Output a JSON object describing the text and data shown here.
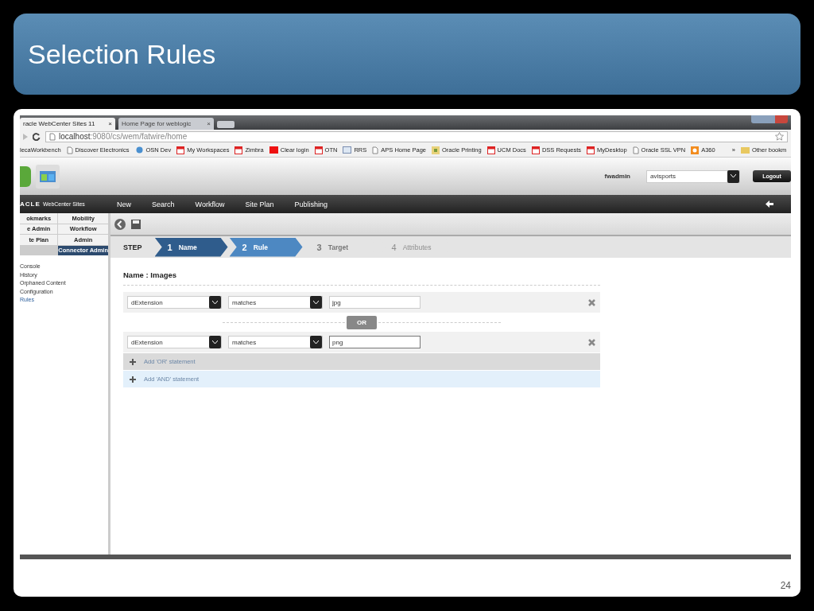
{
  "slide": {
    "title": "Selection Rules",
    "page_number": "24"
  },
  "browser": {
    "tabs": [
      {
        "label": "racle WebCenter Sites 11",
        "close": "×",
        "selected": true
      },
      {
        "label": "Home Page for weblogic",
        "close": "×",
        "selected": false
      }
    ],
    "url_host": "localhost",
    "url_path": ":9080/cs/wem/fatwire/home",
    "bookmarks": [
      {
        "label": "lecaWorkbench",
        "kind": "none"
      },
      {
        "label": "Discover Electronics",
        "kind": "page"
      },
      {
        "label": "OSN Dev",
        "kind": "globe"
      },
      {
        "label": "My Workspaces",
        "kind": "red"
      },
      {
        "label": "Zimbra",
        "kind": "red"
      },
      {
        "label": "Clear login",
        "kind": "redbar"
      },
      {
        "label": "OTN",
        "kind": "red"
      },
      {
        "label": "RRS",
        "kind": "window"
      },
      {
        "label": "APS Home Page",
        "kind": "page"
      },
      {
        "label": "Oracle Printing",
        "kind": "yellow"
      },
      {
        "label": "UCM Docs",
        "kind": "red"
      },
      {
        "label": "DSS Requests",
        "kind": "red"
      },
      {
        "label": "MyDesktop",
        "kind": "red"
      },
      {
        "label": "Oracle SSL VPN",
        "kind": "page"
      },
      {
        "label": "A360",
        "kind": "orange"
      }
    ],
    "overflow": "»",
    "other_bookmarks": "Other bookm"
  },
  "app": {
    "user": "fwadmin",
    "site": "avisports",
    "logout": "Logout",
    "logo": "ACLE",
    "product": "WebCenter Sites",
    "menu": [
      "New",
      "Search",
      "Workflow",
      "Site Plan",
      "Publishing"
    ],
    "sidebar_tabs": [
      {
        "label": "okmarks",
        "selected": false
      },
      {
        "label": "Mobility",
        "selected": false
      },
      {
        "label": "e Admin",
        "selected": false
      },
      {
        "label": "Workflow",
        "selected": false
      },
      {
        "label": "te Plan",
        "selected": false
      },
      {
        "label": "Admin",
        "selected": false
      },
      {
        "label": "Connector Admin",
        "selected": true
      }
    ],
    "sidebar_links": [
      {
        "label": "Console",
        "selected": false
      },
      {
        "label": "History",
        "selected": false
      },
      {
        "label": "Orphaned Content",
        "selected": false
      },
      {
        "label": "Configuration",
        "selected": false
      },
      {
        "label": "Rules",
        "selected": true
      }
    ],
    "steps_label": "STEP",
    "steps": [
      {
        "number": "1",
        "label": "Name",
        "completed": true,
        "selected": false,
        "disabled": false
      },
      {
        "number": "2",
        "label": "Rule",
        "completed": false,
        "selected": true,
        "disabled": false
      },
      {
        "number": "3",
        "label": "Target",
        "completed": false,
        "selected": false,
        "disabled": false
      },
      {
        "number": "4",
        "label": "Attributes",
        "completed": false,
        "selected": false,
        "disabled": true
      }
    ],
    "name_heading": "Name : Images",
    "rules": [
      {
        "field": "dExtension",
        "operator": "matches",
        "value": "jpg",
        "focused": false
      },
      {
        "field": "dExtension",
        "operator": "matches",
        "value": "png",
        "focused": true
      }
    ],
    "or_label": "OR",
    "add_or": "Add 'OR' statement",
    "add_and": "Add 'AND' statement"
  }
}
